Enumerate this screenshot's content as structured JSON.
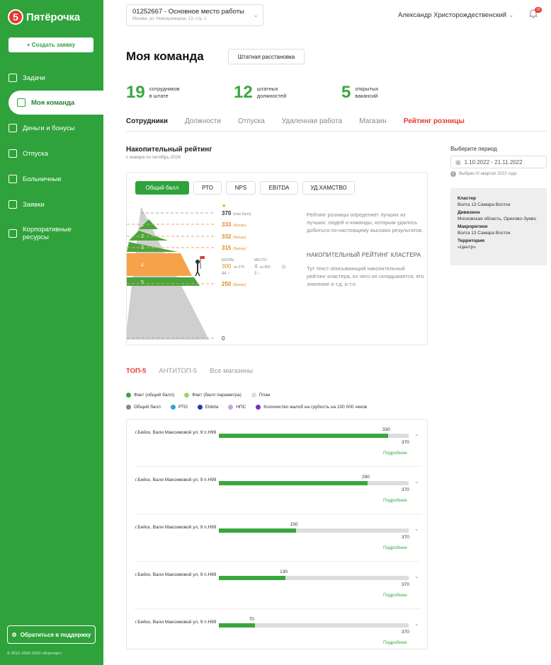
{
  "brand": {
    "logo_text": "Пятёрочка",
    "logo_digit": "5"
  },
  "sidebar": {
    "create_label": "+ Создать заявку",
    "items": [
      {
        "label": "Задачи",
        "icon": "tasks-icon"
      },
      {
        "label": "Моя команда",
        "icon": "team-icon"
      },
      {
        "label": "Деньги и бонусы",
        "icon": "wallet-icon"
      },
      {
        "label": "Отпуска",
        "icon": "vacation-icon"
      },
      {
        "label": "Больничные",
        "icon": "sick-leave-icon"
      },
      {
        "label": "Заявки",
        "icon": "requests-icon"
      },
      {
        "label": "Корпоративные ресурсы",
        "icon": "resources-icon"
      }
    ],
    "support_label": "Обратиться в поддержку",
    "copyright": "© 2012–2020 ООО «Агроторг»"
  },
  "header": {
    "workplace_title": "01252667 - Основное место работы",
    "workplace_sub": "Москва, ул. Новокузнецкая, 13, стр. 1",
    "user": "Александр Христорождественский",
    "notif_count": "19"
  },
  "page": {
    "title": "Моя команда",
    "staff_button": "Штатная расстановка"
  },
  "stats": [
    {
      "num": "19",
      "label1": "сотрудников",
      "label2": "в штате"
    },
    {
      "num": "12",
      "label1": "штатных",
      "label2": "должностей"
    },
    {
      "num": "5",
      "label1": "открытых",
      "label2": "вакансий"
    }
  ],
  "tabs": [
    "Сотрудники",
    "Должности",
    "Отпуска",
    "Удаленная работа",
    "Магазин",
    "Рейтинг розницы"
  ],
  "rating": {
    "title": "Накопительный рейтинг",
    "subtitle": "с января по октябрь 2024",
    "pills": [
      "Общий балл",
      "РТО",
      "NPS",
      "EBITDA",
      "УД.ХАМСТВО"
    ],
    "levels": [
      {
        "value": "370",
        "note": "(max балл)"
      },
      {
        "value": "333",
        "note": "(баллы)"
      },
      {
        "value": "332",
        "note": "(баллы)"
      },
      {
        "value": "315",
        "note": "(баллы)"
      },
      {
        "value": "250",
        "note": "(баллы)"
      },
      {
        "value": "0",
        "note": ""
      }
    ],
    "tiers": [
      "1",
      "2",
      "3",
      "4",
      "5"
    ],
    "score_label": "БАЛЛЫ",
    "score_value": "300",
    "score_of": "из 370",
    "score_prev": "44 ↑",
    "place_label": "МЕСТО",
    "place_value": "4",
    "place_of": "из 865",
    "place_prev": "3 ↓",
    "desc": "Рейтинг розницы определяет лучших из лучших: людей и команды, которым удалось добиться по-настоящему высоких результатов.",
    "cluster_heading": "НАКОПИТЕЛЬНЫЙ РЕЙТИНГ КЛАСТЕРА",
    "cluster_desc": "Тут текст описывающий накопительный рейтинг кластера, из чего он складывается, его значение и т.д. и т.п."
  },
  "period": {
    "label": "Выберите период",
    "value": "1.10.2022 - 21.11.2022",
    "note": "Выбран IV квартал 2022 года"
  },
  "info": [
    {
      "k": "Кластер",
      "v": "Волга 13 Самара Восток"
    },
    {
      "k": "Дивизион",
      "v": "Московская область, Орехово-Зуево"
    },
    {
      "k": "Макрорегион",
      "v": "Волга 13 Самара Восток"
    },
    {
      "k": "Территория",
      "v": "«Центр»"
    }
  ],
  "top_tabs": [
    "ТОП-5",
    "АНТИТОП-5",
    "Все магазины"
  ],
  "legend": [
    [
      {
        "label": "Факт (общий балл)",
        "color": "#3aa63f"
      },
      {
        "label": "Факт (балл параметра)",
        "color": "#9fd66a"
      },
      {
        "label": "План",
        "color": "#ddd"
      }
    ],
    [
      {
        "label": "Общий балл",
        "color": "#888"
      },
      {
        "label": "РТО",
        "color": "#2aa4d8"
      },
      {
        "label": "Ebitda",
        "color": "#1c3fb0"
      },
      {
        "label": "НПС",
        "color": "#c8a2e8"
      },
      {
        "label": "Количество жалоб на грубость на 100 000 чеков",
        "color": "#7b2fc0"
      }
    ]
  ],
  "stores": [
    {
      "addr": "г.Бийск, Вали Максимовой ул, 9 п.Н99",
      "value": 330,
      "max": 370,
      "more": "Подробнее"
    },
    {
      "addr": "г.Бийск, Вали Максимовой ул, 9 п.Н99",
      "value": 290,
      "max": 370,
      "more": "Подробнее"
    },
    {
      "addr": "г.Бийск, Вали Максимовой ул, 9 п.Н99",
      "value": 150,
      "max": 370,
      "more": "Подробнее"
    },
    {
      "addr": "г.Бийск, Вали Максимовой ул, 9 п.Н99",
      "value": 130,
      "max": 370,
      "more": "Подробнее"
    },
    {
      "addr": "г.Бийск, Вали Максимовой ул, 9 п.Н99",
      "value": 70,
      "max": 370,
      "more": "Подробнее"
    }
  ]
}
